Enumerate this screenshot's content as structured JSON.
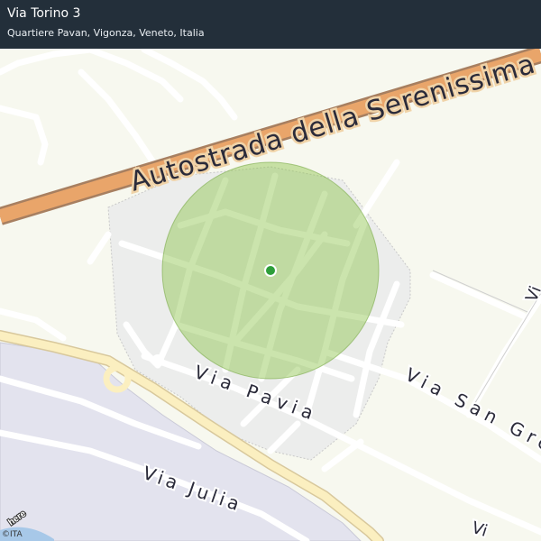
{
  "header": {
    "title": "Via Torino 3",
    "subtitle": "Quartiere Pavan, Vigonza, Veneto, Italia"
  },
  "map": {
    "labels": {
      "highway": "Autostrada della Serenissima",
      "via_pavia": "Via Pavia",
      "via_san_gregorio": "Via San Gregorio",
      "via_julia": "Via Julia",
      "via_partial_right": "Vi",
      "via_partial_bottom": "Vi"
    },
    "provider_logo": "here",
    "copyright": "©ITA",
    "colors": {
      "accuracy_circle": "#8bc34a",
      "location_dot": "#2e9e3a",
      "highway": "#e9a56a",
      "header": "#232f3a"
    }
  }
}
